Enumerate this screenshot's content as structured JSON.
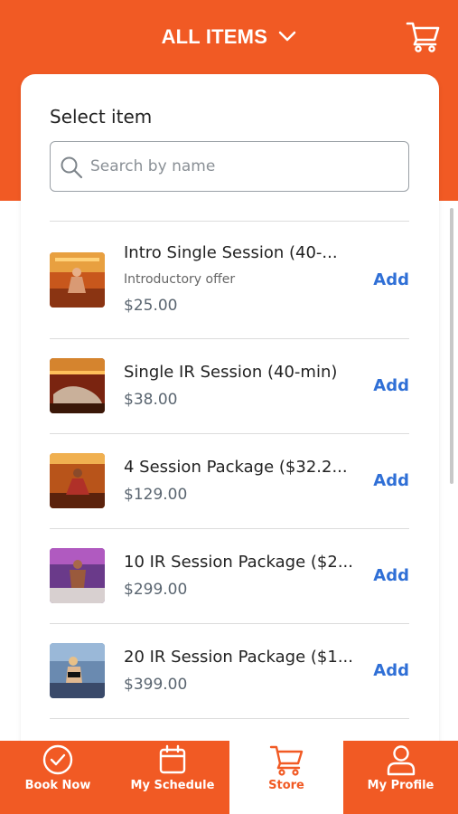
{
  "header": {
    "title": "ALL ITEMS"
  },
  "card": {
    "title": "Select item"
  },
  "search": {
    "placeholder": "Search by name",
    "value": ""
  },
  "items": [
    {
      "name": "Intro Single Session (40-...",
      "subtitle": "Introductory offer",
      "price": "$25.00",
      "action": "Add"
    },
    {
      "name": "Single IR Session (40-min)",
      "subtitle": "",
      "price": "$38.00",
      "action": "Add"
    },
    {
      "name": "4 Session Package ($32.2...",
      "subtitle": "",
      "price": "$129.00",
      "action": "Add"
    },
    {
      "name": "10 IR Session Package ($2...",
      "subtitle": "",
      "price": "$299.00",
      "action": "Add"
    },
    {
      "name": "20 IR Session Package ($1...",
      "subtitle": "",
      "price": "$399.00",
      "action": "Add"
    }
  ],
  "bottom_nav": [
    {
      "label": "Book Now",
      "icon": "check-circle-icon"
    },
    {
      "label": "My Schedule",
      "icon": "calendar-icon"
    },
    {
      "label": "Store",
      "icon": "cart-icon",
      "active": true
    },
    {
      "label": "My Profile",
      "icon": "person-icon"
    }
  ],
  "colors": {
    "brand": "#F15A24",
    "link": "#2F6FD6"
  }
}
